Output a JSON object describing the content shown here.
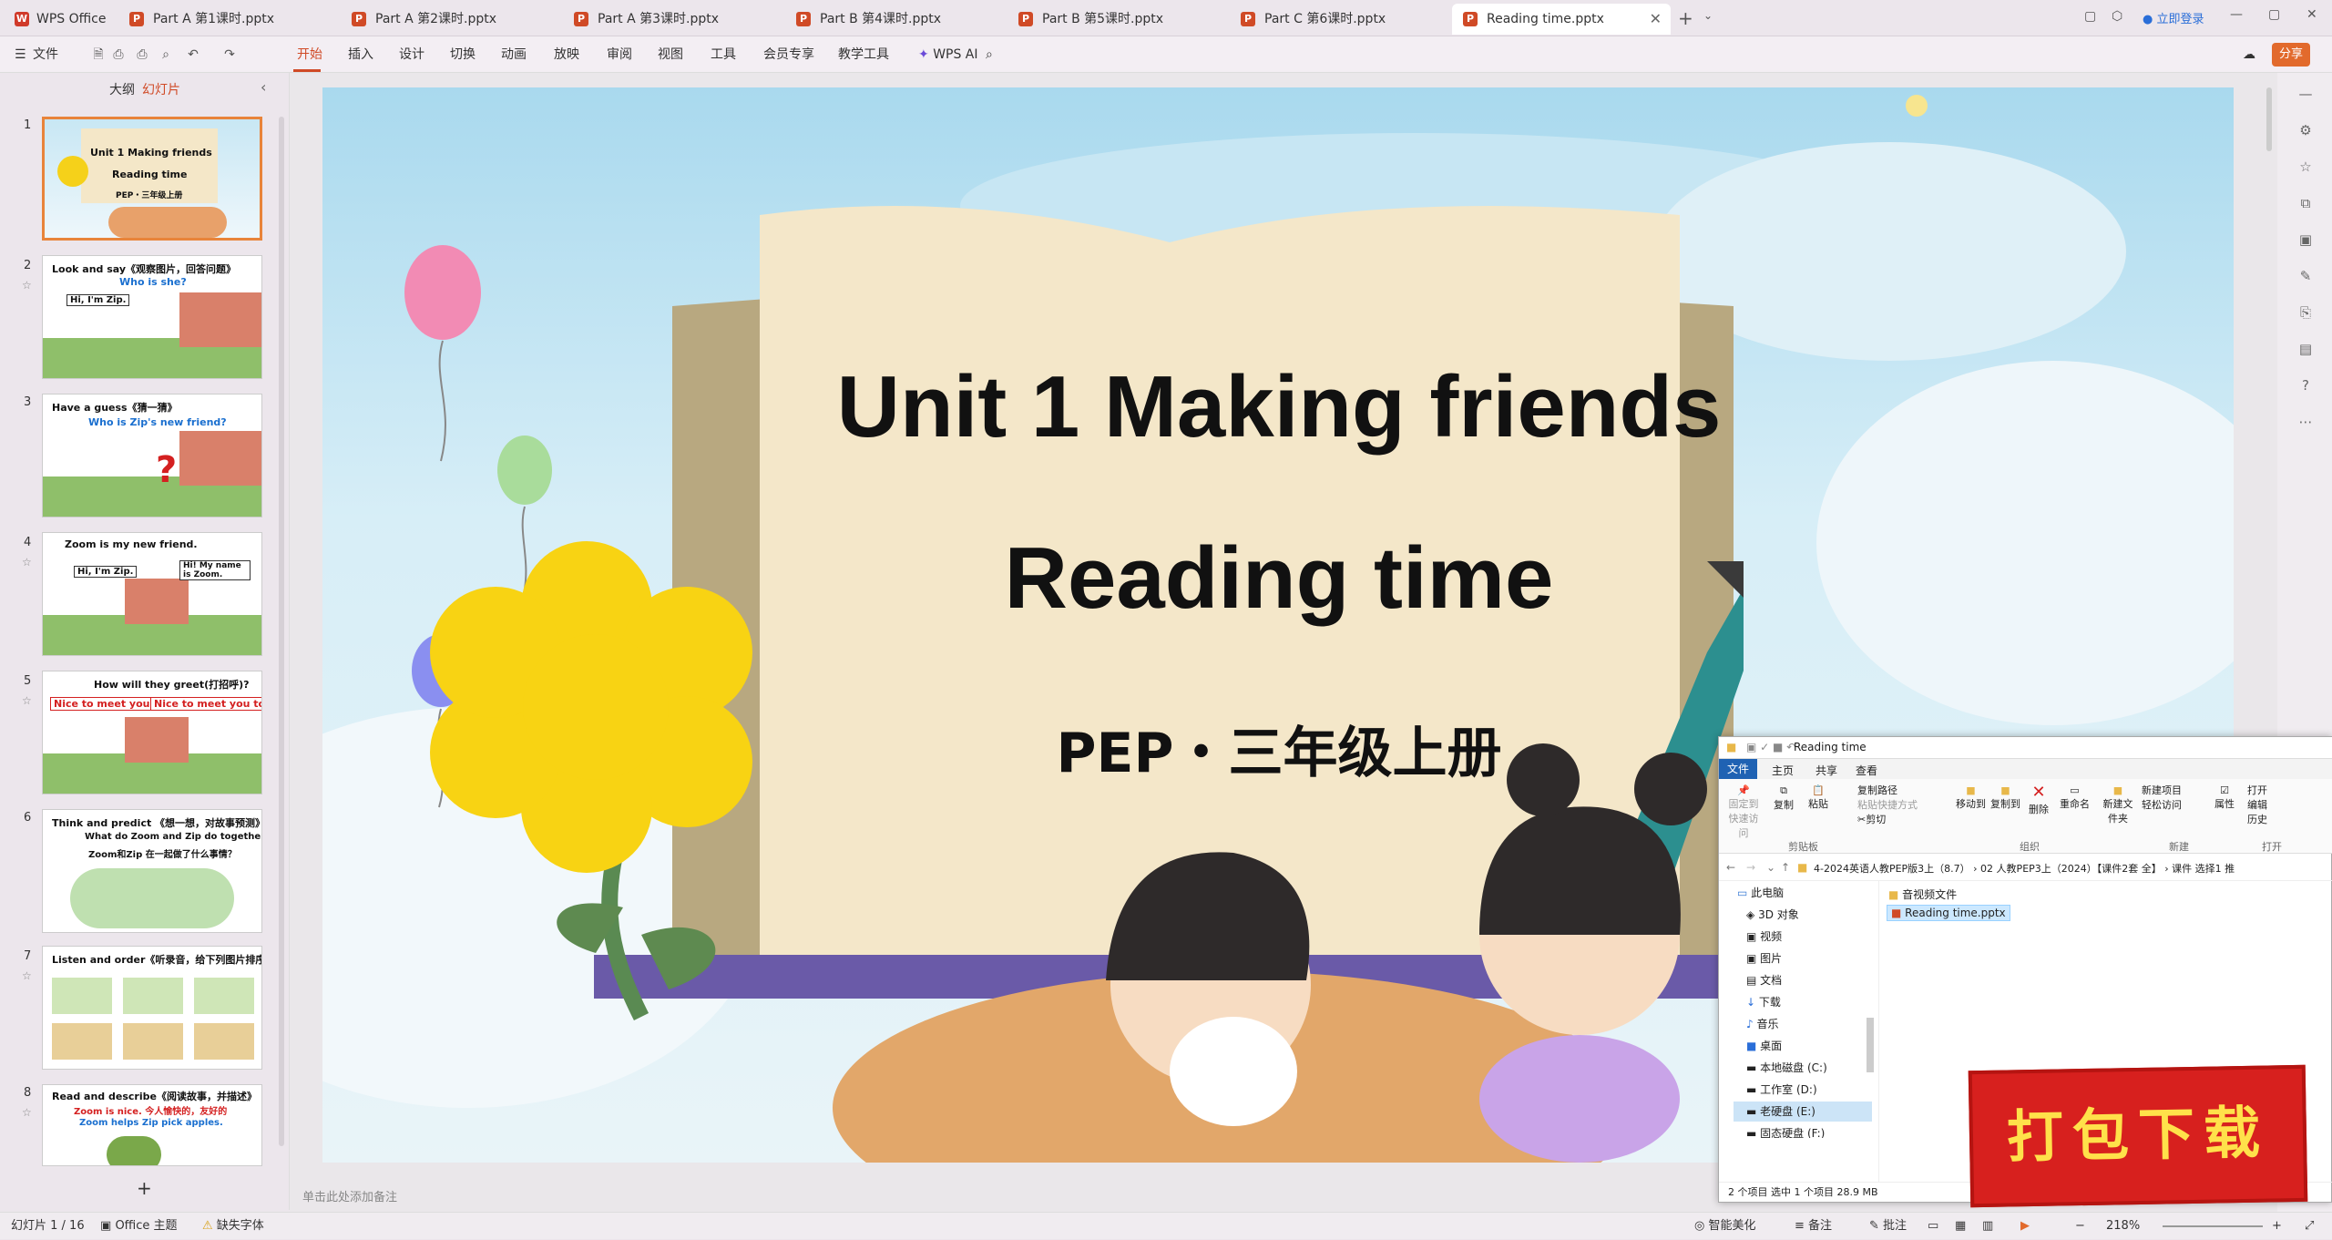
{
  "app": {
    "name": "WPS Office"
  },
  "tabs": [
    {
      "label": "Part  A 第1课时.pptx"
    },
    {
      "label": "Part  A 第2课时.pptx"
    },
    {
      "label": "Part  A 第3课时.pptx"
    },
    {
      "label": "Part  B 第4课时.pptx"
    },
    {
      "label": "Part  B 第5课时.pptx"
    },
    {
      "label": "Part  C 第6课时.pptx"
    },
    {
      "label": "Reading time.pptx"
    }
  ],
  "titlebar": {
    "login": "立即登录"
  },
  "toolbar": {
    "file": "文件",
    "menus": [
      "开始",
      "插入",
      "设计",
      "切换",
      "动画",
      "放映",
      "审阅",
      "视图",
      "工具",
      "会员专享",
      "教学工具"
    ],
    "ai": "WPS AI",
    "share": "分享"
  },
  "panel": {
    "tab_outline": "大纲",
    "tab_slides": "幻灯片"
  },
  "thumbs": [
    {
      "num": "1",
      "l1": "Unit 1 Making friends",
      "l2": "Reading time",
      "l3": "PEP・三年级上册"
    },
    {
      "num": "2",
      "l1": "Look and say《观察图片，回答问题》",
      "l2": "Who is she?",
      "l3": "Hi, I'm Zip."
    },
    {
      "num": "3",
      "l1": "Have a guess《猜一猜》",
      "l2": "Who is Zip's new friend?",
      "l3": ""
    },
    {
      "num": "4",
      "l1": "Zoom is my new friend.",
      "l2": "Hi, I'm Zip.",
      "l3": "Hi! My name is Zoom."
    },
    {
      "num": "5",
      "l1": "How will they greet(打招呼)?",
      "l2": "Nice to meet you.",
      "l3": "Nice to meet you too."
    },
    {
      "num": "6",
      "l1": "Think and predict 《想一想，对故事预测》",
      "l2": "What do Zoom and Zip do together?",
      "l3": "Zoom和Zip 在一起做了什么事情？"
    },
    {
      "num": "7",
      "l1": "Listen and order《听录音，给下列图片排序》",
      "l2": "",
      "l3": ""
    },
    {
      "num": "8",
      "l1": "Read and describe《阅读故事，并描述》",
      "l2": "Zoom is nice. 今人愉快的，友好的",
      "l3": "Zoom helps Zip pick apples."
    }
  ],
  "slide": {
    "title1": "Unit 1 Making friends",
    "title2": "Reading time",
    "subtitle": "PEP・三年级上册"
  },
  "notes": {
    "placeholder": "单击此处添加备注"
  },
  "status": {
    "slide_pos": "幻灯片 1 / 16",
    "theme": "Office 主题",
    "font_missing": "缺失字体",
    "beautify": "智能美化",
    "notes_btn": "备注",
    "comment_btn": "批注",
    "zoom": "218%"
  },
  "explorer": {
    "title": "Reading time",
    "ribbon_tabs": [
      "文件",
      "主页",
      "共享",
      "查看"
    ],
    "groups": [
      "剪贴板",
      "组织",
      "新建",
      "打开"
    ],
    "btns": [
      "固定到快速访问",
      "复制",
      "粘贴",
      "复制路径",
      "粘贴快捷方式",
      "剪切",
      "移动到",
      "复制到",
      "删除",
      "重命名",
      "新建文件夹",
      "新建项目",
      "轻松访问",
      "属性",
      "打开",
      "编辑",
      "历史"
    ],
    "path": "4-2024英语人教PEP版3上（8.7）  ›  02 人教PEP3上（2024）【课件2套 全】  ›  课件 选择1 推",
    "tree": [
      "此电脑",
      "3D 对象",
      "视频",
      "图片",
      "文档",
      "下载",
      "音乐",
      "桌面",
      "本地磁盘 (C:)",
      "工作室 (D:)",
      "老硬盘 (E:)",
      "固态硬盘 (F:)"
    ],
    "files": [
      "音视频文件",
      "Reading time.pptx"
    ],
    "status": "2 个项目    选中 1 个项目  28.9 MB"
  },
  "badge": {
    "label": "打包下载"
  },
  "colors": {
    "accent": "#d04a26",
    "slide_title": "#111111"
  }
}
